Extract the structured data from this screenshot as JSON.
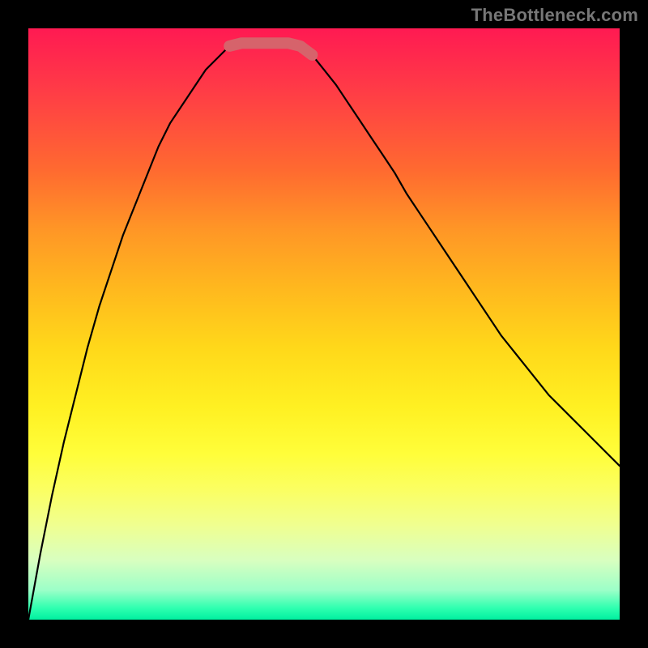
{
  "watermark": {
    "text": "TheBottleneck.com"
  },
  "chart_data": {
    "type": "line",
    "x": [
      0.0,
      0.02,
      0.04,
      0.06,
      0.08,
      0.1,
      0.12,
      0.14,
      0.16,
      0.18,
      0.2,
      0.22,
      0.24,
      0.26,
      0.28,
      0.3,
      0.32,
      0.34,
      0.36,
      0.38,
      0.4,
      0.42,
      0.44,
      0.46,
      0.48,
      0.5,
      0.52,
      0.54,
      0.56,
      0.58,
      0.6,
      0.62,
      0.64,
      0.66,
      0.68,
      0.7,
      0.72,
      0.74,
      0.76,
      0.78,
      0.8,
      0.82,
      0.84,
      0.86,
      0.88,
      0.9,
      0.92,
      0.94,
      0.96,
      0.98,
      1.0
    ],
    "y": [
      0.0,
      0.11,
      0.21,
      0.3,
      0.38,
      0.46,
      0.53,
      0.59,
      0.65,
      0.7,
      0.75,
      0.8,
      0.84,
      0.87,
      0.9,
      0.93,
      0.95,
      0.97,
      0.975,
      0.975,
      0.975,
      0.975,
      0.975,
      0.97,
      0.955,
      0.93,
      0.905,
      0.875,
      0.845,
      0.815,
      0.785,
      0.755,
      0.72,
      0.69,
      0.66,
      0.63,
      0.6,
      0.57,
      0.54,
      0.51,
      0.48,
      0.455,
      0.43,
      0.405,
      0.38,
      0.36,
      0.34,
      0.32,
      0.3,
      0.28,
      0.26
    ],
    "xlim": [
      0,
      1
    ],
    "ylim": [
      0,
      1
    ],
    "xlabel": "",
    "ylabel": "",
    "title": "",
    "highlight_range_x": [
      0.34,
      0.48
    ],
    "colors": {
      "curve": "#000000",
      "highlight": "#d6636b",
      "gradient_top": "#ff1a52",
      "gradient_bottom": "#00f0a0"
    }
  }
}
